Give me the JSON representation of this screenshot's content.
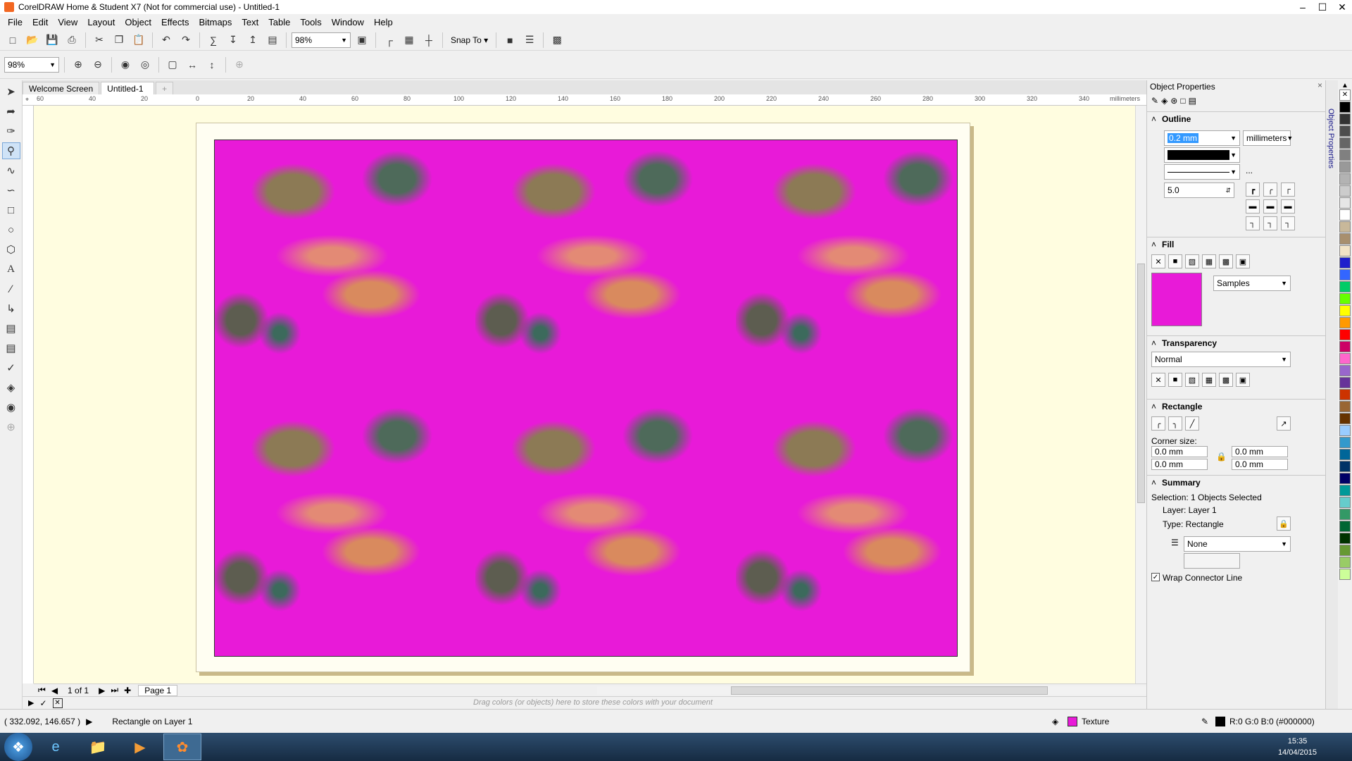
{
  "window": {
    "title": "CorelDRAW Home & Student X7 (Not for commercial use) - Untitled-1",
    "minimize": "–",
    "maximize": "☐",
    "close": "✕"
  },
  "menu": [
    "File",
    "Edit",
    "View",
    "Layout",
    "Object",
    "Effects",
    "Bitmaps",
    "Text",
    "Table",
    "Tools",
    "Window",
    "Help"
  ],
  "toolbar": {
    "zoom_value": "98%",
    "snap_to": "Snap To"
  },
  "property_bar": {
    "zoom_value": "98%"
  },
  "tabs": {
    "welcome": "Welcome Screen",
    "doc": "Untitled-1",
    "add": "+"
  },
  "ruler": {
    "units": "millimeters",
    "ticks": [
      "60",
      "40",
      "20",
      "0",
      "20",
      "40",
      "60",
      "80",
      "100",
      "120",
      "140",
      "160",
      "180",
      "200",
      "220",
      "240",
      "260",
      "280",
      "300",
      "320",
      "340"
    ]
  },
  "pagebar": {
    "counter": "1 of 1",
    "page_tab": "Page 1"
  },
  "doc_palette_hint": "Drag colors (or objects) here to store these colors with your document",
  "panel": {
    "title": "Object Properties",
    "outline": {
      "header": "Outline",
      "width": "0.2 mm",
      "units": "millimeters",
      "miter": "5.0",
      "more": "..."
    },
    "fill": {
      "header": "Fill",
      "library": "Samples"
    },
    "transparency": {
      "header": "Transparency",
      "mode": "Normal"
    },
    "rectangle": {
      "header": "Rectangle",
      "corner_label": "Corner size:",
      "c1": "0.0 mm",
      "c2": "0.0 mm",
      "c3": "0.0 mm",
      "c4": "0.0 mm"
    },
    "summary": {
      "header": "Summary",
      "selection": "Selection: 1 Objects Selected",
      "layer": "Layer:  Layer 1",
      "type": "Type:  Rectangle",
      "wrap_value": "None",
      "wrap_connector": "Wrap Connector Line"
    }
  },
  "dock_label": "Object Properties",
  "status": {
    "coords": "( 332.092, 146.657 )",
    "info": "Rectangle on Layer 1",
    "fill_name": "Texture",
    "outline_info": "R:0 G:0 B:0 (#000000)"
  },
  "taskbar": {
    "time": "15:35",
    "date": "14/04/2015"
  },
  "palette_colors": [
    "#000000",
    "#333333",
    "#4d4d4d",
    "#666666",
    "#808080",
    "#999999",
    "#b3b3b3",
    "#cccccc",
    "#e6e6e6",
    "#ffffff",
    "#c8b89a",
    "#a88f6e",
    "#f2e3c6",
    "#1f1fcc",
    "#3366ff",
    "#00cc66",
    "#66ff00",
    "#ffff00",
    "#ff9900",
    "#ff0000",
    "#cc0066",
    "#ff66cc",
    "#9966cc",
    "#663399",
    "#cc3300",
    "#996633",
    "#663300",
    "#99ccff",
    "#3399cc",
    "#006699",
    "#003366",
    "#000066",
    "#009999",
    "#66cccc",
    "#339966",
    "#006633",
    "#003300",
    "#669933",
    "#99cc66",
    "#ccff99"
  ]
}
